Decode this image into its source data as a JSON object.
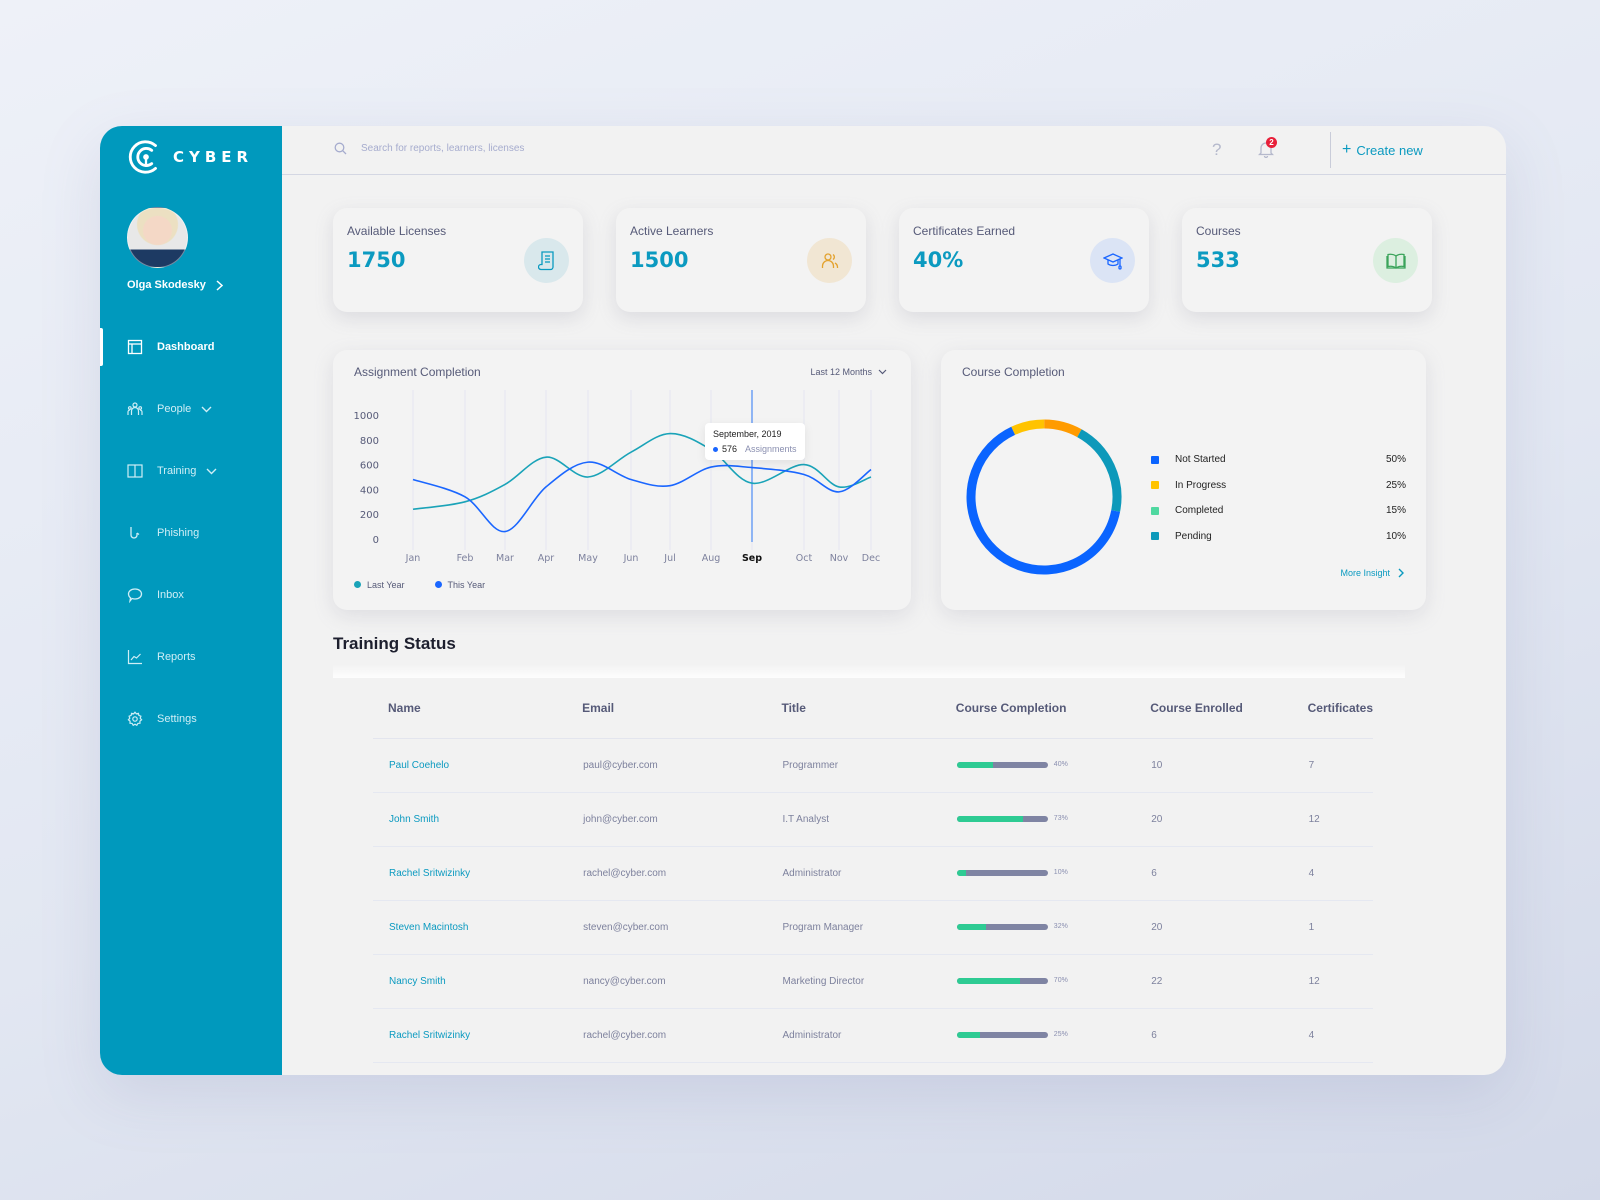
{
  "app": {
    "brand": "CYBER"
  },
  "user": {
    "name": "Olga Skodesky"
  },
  "sidebar": {
    "items": [
      {
        "label": "Dashboard",
        "icon": "dashboard-icon",
        "active": true
      },
      {
        "label": "People",
        "icon": "people-icon",
        "expandable": true
      },
      {
        "label": "Training",
        "icon": "book-icon",
        "expandable": true
      },
      {
        "label": "Phishing",
        "icon": "hook-icon"
      },
      {
        "label": "Inbox",
        "icon": "chat-bubble-icon"
      },
      {
        "label": "Reports",
        "icon": "line-chart-icon"
      },
      {
        "label": "Settings",
        "icon": "gear-icon"
      }
    ]
  },
  "topbar": {
    "search_placeholder": "Search for reports, learners, licenses",
    "help_icon": "?",
    "notification_count": "2",
    "create_label": "Create new",
    "create_icon": "+"
  },
  "stats": [
    {
      "label": "Available Licenses",
      "value": "1750",
      "icon": "scroll-icon",
      "icon_bg": "#d9e8ec",
      "icon_color": "#0b9ac0"
    },
    {
      "label": "Active Learners",
      "value": "1500",
      "icon": "users-icon",
      "icon_bg": "#f1e6d3",
      "icon_color": "#e3a22e"
    },
    {
      "label": "Certificates Earned",
      "value": "40%",
      "icon": "graduation-cap-icon",
      "icon_bg": "#dbe4f5",
      "icon_color": "#1a66ff"
    },
    {
      "label": "Courses",
      "value": "533",
      "icon": "open-book-icon",
      "icon_bg": "#dcefe0",
      "icon_color": "#3aa35a"
    }
  ],
  "assignment_panel": {
    "title": "Assignment Completion",
    "range": "Last 12 Months",
    "tooltip": {
      "title": "September, 2019",
      "value": "576",
      "unit": "Assignments"
    }
  },
  "course_panel": {
    "title": "Course Completion",
    "more_label": "More Insight"
  },
  "chart_data": [
    {
      "type": "line",
      "title": "Assignment Completion",
      "categories": [
        "Jan",
        "Feb",
        "Mar",
        "Apr",
        "May",
        "Jun",
        "Jul",
        "Aug",
        "Sep",
        "Oct",
        "Nov",
        "Dec"
      ],
      "highlight_category": "Sep",
      "yticks": [
        0,
        200,
        400,
        600,
        800,
        1000
      ],
      "ylim": [
        0,
        1000
      ],
      "grid": "vertical",
      "legend": "bottom-left",
      "series": [
        {
          "name": "Last Year",
          "color": "#1aa3b8",
          "values": [
            240,
            300,
            440,
            660,
            500,
            700,
            850,
            720,
            450,
            600,
            420,
            500
          ]
        },
        {
          "name": "This Year",
          "color": "#1a66ff",
          "values": [
            480,
            340,
            60,
            420,
            620,
            480,
            430,
            580,
            576,
            520,
            380,
            560
          ]
        }
      ]
    },
    {
      "type": "pie",
      "title": "Course Completion",
      "legend": "right",
      "slices": [
        {
          "label": "Not Started",
          "value": 50,
          "display": "50%",
          "color": "#0a64ff"
        },
        {
          "label": "In Progress",
          "value": 25,
          "display": "25%",
          "color": "#ffc300"
        },
        {
          "label": "Completed",
          "value": 15,
          "display": "15%",
          "color": "#4fd8a0"
        },
        {
          "label": "Pending",
          "value": 10,
          "display": "10%",
          "color": "#0d99ba"
        }
      ],
      "ring_segments": [
        {
          "color": "#ffc300",
          "fraction": 0.07
        },
        {
          "color": "#ff9b00",
          "fraction": 0.08
        },
        {
          "color": "#0d99ba",
          "fraction": 0.2
        },
        {
          "color": "#0a64ff",
          "fraction": 0.65
        }
      ]
    }
  ],
  "training": {
    "title": "Training Status",
    "columns": [
      "Name",
      "Email",
      "Title",
      "Course Completion",
      "Course Enrolled",
      "Certificates"
    ],
    "rows": [
      {
        "name": "Paul Coehelo",
        "email": "paul@cyber.com",
        "title": "Programmer",
        "completion": 40,
        "completion_label": "40%",
        "enrolled": "10",
        "certificates": "7"
      },
      {
        "name": "John Smith",
        "email": "john@cyber.com",
        "title": "I.T Analyst",
        "completion": 73,
        "completion_label": "73%",
        "enrolled": "20",
        "certificates": "12"
      },
      {
        "name": "Rachel Sritwizinky",
        "email": "rachel@cyber.com",
        "title": "Administrator",
        "completion": 10,
        "completion_label": "10%",
        "enrolled": "6",
        "certificates": "4"
      },
      {
        "name": "Steven Macintosh",
        "email": "steven@cyber.com",
        "title": "Program Manager",
        "completion": 32,
        "completion_label": "32%",
        "enrolled": "20",
        "certificates": "1"
      },
      {
        "name": "Nancy Smith",
        "email": "nancy@cyber.com",
        "title": "Marketing Director",
        "completion": 70,
        "completion_label": "70%",
        "enrolled": "22",
        "certificates": "12"
      },
      {
        "name": "Rachel Sritwizinky",
        "email": "rachel@cyber.com",
        "title": "Administrator",
        "completion": 25,
        "completion_label": "25%",
        "enrolled": "6",
        "certificates": "4"
      }
    ]
  }
}
